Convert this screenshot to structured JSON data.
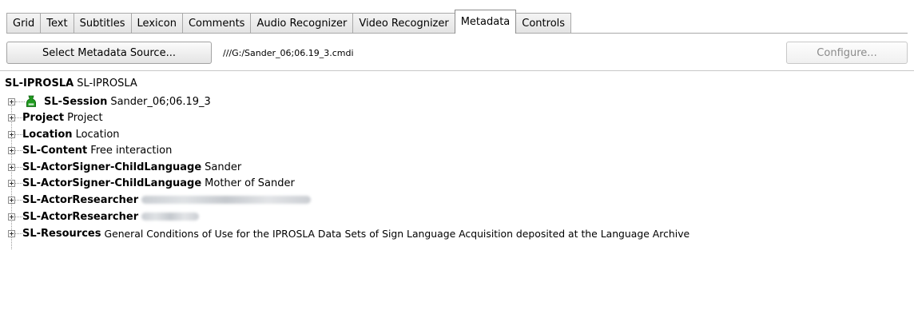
{
  "tabs": [
    {
      "label": "Grid",
      "active": false
    },
    {
      "label": "Text",
      "active": false
    },
    {
      "label": "Subtitles",
      "active": false
    },
    {
      "label": "Lexicon",
      "active": false
    },
    {
      "label": "Comments",
      "active": false
    },
    {
      "label": "Audio Recognizer",
      "active": false
    },
    {
      "label": "Video Recognizer",
      "active": false
    },
    {
      "label": "Metadata",
      "active": true
    },
    {
      "label": "Controls",
      "active": false
    }
  ],
  "toolbar": {
    "select_source_label": "Select Metadata Source...",
    "source_path": "///G:/Sander_06;06.19_3.cmdi",
    "configure_label": "Configure..."
  },
  "tree": {
    "root": {
      "key": "SL-IPROSLA",
      "value": "SL-IPROSLA"
    },
    "items": [
      {
        "key": "SL-Session",
        "value": "Sander_06;06.19_3",
        "icon": "session-icon"
      },
      {
        "key": "Project",
        "value": "Project"
      },
      {
        "key": "Location",
        "value": "Location"
      },
      {
        "key": "SL-Content",
        "value": "Free interaction"
      },
      {
        "key": "SL-ActorSigner-ChildLanguage",
        "value": "Sander"
      },
      {
        "key": "SL-ActorSigner-ChildLanguage",
        "value": "Mother of Sander"
      },
      {
        "key": "SL-ActorResearcher",
        "value": "",
        "redacted": true
      },
      {
        "key": "SL-ActorResearcher",
        "value": "",
        "redacted": true
      },
      {
        "key": "SL-Resources",
        "value": "General Conditions of Use for the IPROSLA Data Sets of Sign Language Acquisition deposited at the Language Archive"
      }
    ]
  },
  "colors": {
    "session_icon": "#1f9a1f",
    "tab_border": "#a9a9a9",
    "disabled_text": "#8a8a8a"
  }
}
